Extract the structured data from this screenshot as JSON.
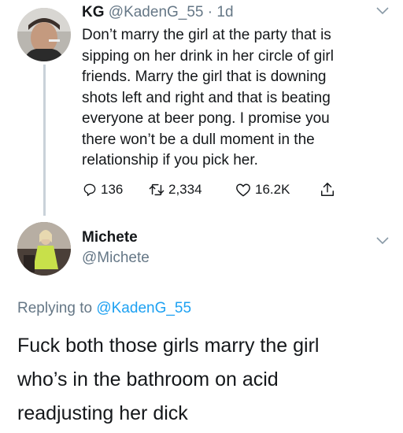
{
  "tweet1": {
    "display_name": "KG",
    "handle": "@KadenG_55",
    "separator": "·",
    "time": "1d",
    "lines": [
      "Don’t marry the girl at the party that is",
      "sipping on her drink in her circle of girl",
      "friends. Marry the girl that is downing",
      "shots left and right and that is beating",
      "everyone at beer pong. I promise you",
      "there won’t be a dull moment in the",
      "relationship if you pick her."
    ],
    "replies": "136",
    "retweets": "2,334",
    "likes": "16.2K"
  },
  "tweet2": {
    "display_name": "Michete",
    "handle": "@Michete",
    "replying_prefix": "Replying to",
    "replying_handle": "@KadenG_55",
    "lines": [
      "Fuck both those girls marry the girl",
      "who’s in the bathroom on acid",
      "readjusting her dick"
    ]
  },
  "colors": {
    "text": "#14171a",
    "secondary": "#657786",
    "link": "#1da1f2",
    "thread_line": "#c9d2d9"
  },
  "icons": [
    "chevron-down-icon",
    "reply-icon",
    "retweet-icon",
    "like-icon",
    "share-icon"
  ]
}
